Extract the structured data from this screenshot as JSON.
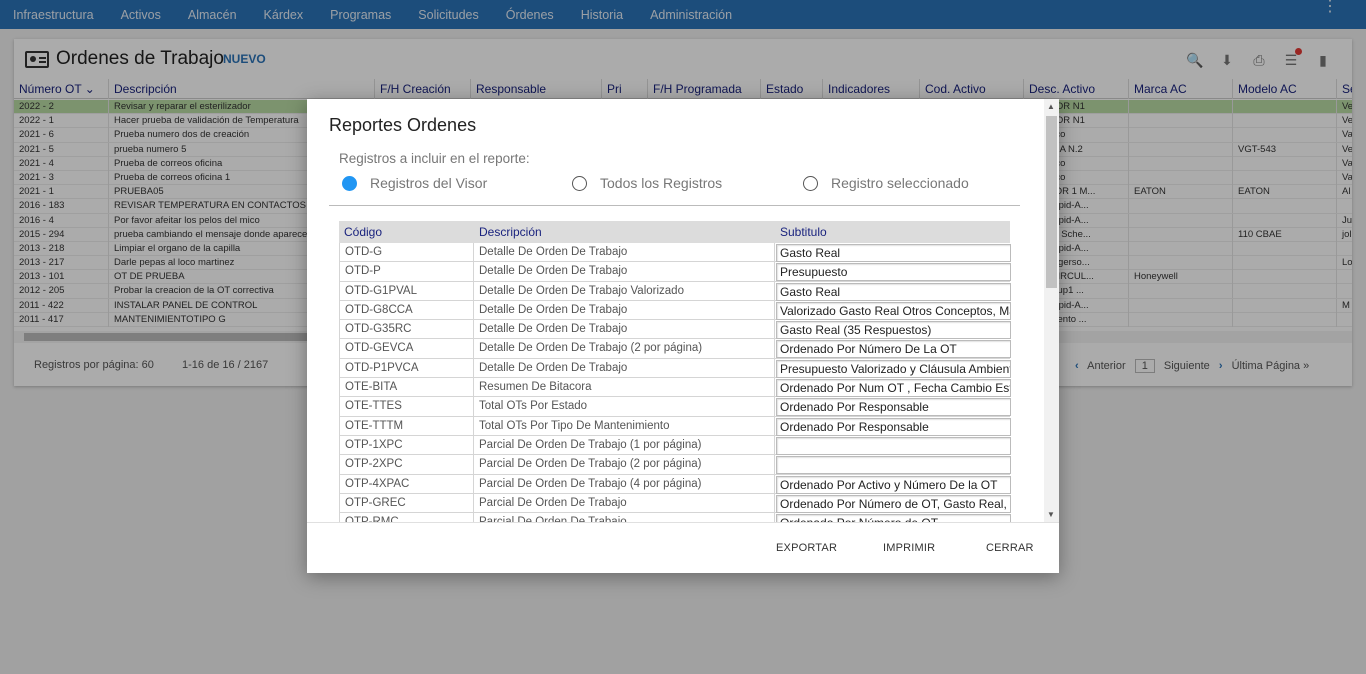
{
  "nav": {
    "items": [
      "Infraestructura",
      "Activos",
      "Almacén",
      "Kárdex",
      "Programas",
      "Solicitudes",
      "Órdenes",
      "Historia",
      "Administración"
    ],
    "menu_icon": "kebab-menu-icon"
  },
  "panel": {
    "title": "Ordenes de Trabajo",
    "new_label": "NUEVO",
    "columns": [
      "Número OT",
      "Descripción",
      "F/H Creación",
      "Responsable",
      "Pri",
      "F/H Programada",
      "Estado",
      "Indicadores",
      "Cod. Activo",
      "Desc. Activo",
      "Marca AC",
      "Modelo AC",
      "Se"
    ],
    "rows": [
      {
        "num": "2022 - 2",
        "desc": "Revisar y reparar el esterilizador",
        "dact": "LIZADOR N1",
        "marca": "",
        "modelo": "",
        "s": "Ve",
        "selected": true
      },
      {
        "num": "2022 - 1",
        "desc": "Hacer prueba de validación de Temperatura",
        "dact": "LIZADOR N1",
        "marca": "",
        "modelo": "",
        "s": "Ve"
      },
      {
        "num": "2021 - 6",
        "desc": "Prueba numero dos de creación",
        "dact": "genérico",
        "marca": "",
        "modelo": "",
        "s": "Va"
      },
      {
        "num": "2021 - 5",
        "desc": "prueba numero 5",
        "dact": "RIDORA N.2",
        "marca": "",
        "modelo": "VGT-543",
        "s": "Ve"
      },
      {
        "num": "2021 - 4",
        "desc": "Prueba de correos oficina",
        "dact": "generico",
        "marca": "",
        "modelo": "",
        "s": "Va"
      },
      {
        "num": "2021 - 3",
        "desc": "Prueba de correos oficina 1",
        "dact": "generico",
        "marca": "",
        "modelo": "",
        "s": "Va"
      },
      {
        "num": "2021 - 1",
        "desc": "PRUEBA05",
        "dact": "RUPTOR 1 M...",
        "marca": "EATON",
        "modelo": "EATON",
        "s": "Al"
      },
      {
        "num": "2016 - 183",
        "desc": "REVISAR TEMPERATURA EN CONTACTOS",
        "dact": "leje Rapid-A...",
        "marca": "",
        "modelo": "",
        "s": ""
      },
      {
        "num": "2016 - 4",
        "desc": "Por favor afeitar los pelos del mico",
        "dact": "leje Rapid-A...",
        "marca": "",
        "modelo": "",
        "s": "Ju"
      },
      {
        "num": "2015 - 294",
        "desc": "prueba cambiando el mensaje donde aparece",
        "dact": "eadora Sche...",
        "marca": "",
        "modelo": "110 CBAE",
        "s": "jol"
      },
      {
        "num": "2013 - 218",
        "desc": "Limpiar el organo de la capilla",
        "dact": "leje Rapid-A...",
        "marca": "",
        "modelo": "",
        "s": ""
      },
      {
        "num": "2013 - 217",
        "desc": "Darle pepas al loco martinez",
        "dact": "esor Ingerso...",
        "marca": "",
        "modelo": "",
        "s": "Lo"
      },
      {
        "num": "2013 - 101",
        "desc": "OT DE PRUEBA",
        "dact": "A RECIRCUL...",
        "marca": "Honeywell",
        "modelo": "",
        "s": ""
      },
      {
        "num": "2012 - 205",
        "desc": "Probar la creacion de la OT correctiva",
        "dact": "rrug. Sup1 ...",
        "marca": "",
        "modelo": "",
        "s": ""
      },
      {
        "num": "2011 - 422",
        "desc": "INSTALAR PANEL DE CONTROL",
        "dact": "leje Rapid-A...",
        "marca": "",
        "modelo": "",
        "s": "M"
      },
      {
        "num": "2011 - 417",
        "desc": "MANTENIMIENTOTIPO G",
        "dact": "entamiento ...",
        "marca": "",
        "modelo": "",
        "s": ""
      }
    ],
    "footer": {
      "per_page": "Registros por página: 60",
      "range": "1-16 de 16 / 2167",
      "prev": "Anterior",
      "page": "1",
      "next": "Siguiente",
      "last": "Última Página »"
    }
  },
  "modal": {
    "title": "Reportes Ordenes",
    "subtitle": "Registros a incluir en el reporte:",
    "radios": [
      "Registros del Visor",
      "Todos los Registros",
      "Registro seleccionado"
    ],
    "selected_radio": 0,
    "headers": [
      "Código",
      "Descripción",
      "Subtitulo"
    ],
    "rows": [
      {
        "code": "OTD-G",
        "desc": "Detalle De Orden De Trabajo",
        "sub": "Gasto Real"
      },
      {
        "code": "OTD-P",
        "desc": "Detalle De Orden De Trabajo",
        "sub": "Presupuesto"
      },
      {
        "code": "OTD-G1PVAL",
        "desc": "Detalle De Orden De Trabajo Valorizado",
        "sub": "Gasto Real"
      },
      {
        "code": "OTD-G8CCA",
        "desc": "Detalle De Orden De Trabajo",
        "sub": "Valorizado Gasto Real Otros Conceptos, Mat"
      },
      {
        "code": "OTD-G35RC",
        "desc": "Detalle De Orden De Trabajo",
        "sub": "Gasto Real (35 Respuestos)"
      },
      {
        "code": "OTD-GEVCA",
        "desc": "Detalle De Orden De Trabajo (2 por página)",
        "sub": "Ordenado Por Número De La OT"
      },
      {
        "code": "OTD-P1PVCA",
        "desc": "Detalle De Orden De Trabajo",
        "sub": "Presupuesto Valorizado y Cláusula Ambienta"
      },
      {
        "code": "OTE-BITA",
        "desc": "Resumen De Bitacora",
        "sub": "Ordenado Por Num OT , Fecha Cambio Estad"
      },
      {
        "code": "OTE-TTES",
        "desc": "Total OTs Por Estado",
        "sub": "Ordenado Por Responsable"
      },
      {
        "code": "OTE-TTTM",
        "desc": "Total OTs Por Tipo De Mantenimiento",
        "sub": "Ordenado Por Responsable"
      },
      {
        "code": "OTP-1XPC",
        "desc": "Parcial De Orden De Trabajo (1 por página)",
        "sub": ""
      },
      {
        "code": "OTP-2XPC",
        "desc": "Parcial De Orden De Trabajo (2 por página)",
        "sub": ""
      },
      {
        "code": "OTP-4XPAC",
        "desc": "Parcial De Orden De Trabajo (4 por página)",
        "sub": "Ordenado Por Activo y Número De la OT"
      },
      {
        "code": "OTP-GREC",
        "desc": "Parcial De Orden De Trabajo",
        "sub": "Ordenado Por Número de OT, Gasto Real, Co"
      },
      {
        "code": "OTP-RMC",
        "desc": "Parcial De Orden De Trabajo",
        "sub": "Ordenado Por Número de OT"
      }
    ],
    "actions": {
      "export": "EXPORTAR",
      "print": "IMPRIMIR",
      "close": "CERRAR"
    }
  }
}
